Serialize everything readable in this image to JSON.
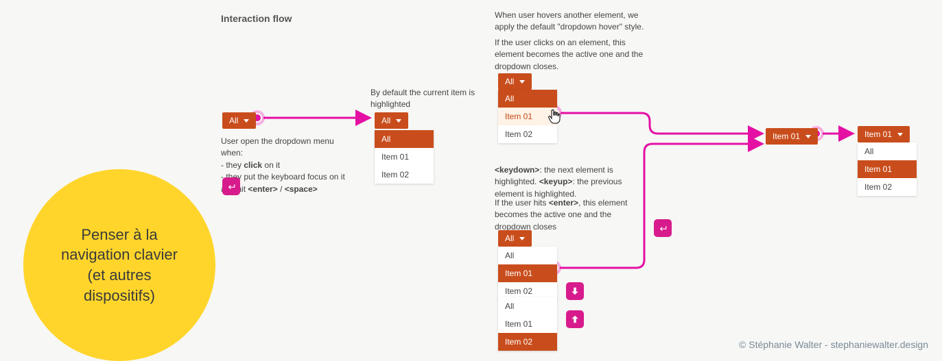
{
  "title": "Interaction flow",
  "circle_text": "Penser à la navigation clavier (et autres dispositifs)",
  "col1": {
    "btn": "All",
    "desc_line1": "User open the dropdown menu when:",
    "desc_line2_a": "- they ",
    "desc_line2_b": "click",
    "desc_line2_c": " on it",
    "desc_line3_a": "- they put the keyboard focus on it and hit ",
    "desc_line3_b": "<enter>",
    "desc_line3_c": " / ",
    "desc_line3_d": "<space>"
  },
  "col2": {
    "desc": "By default the current item is highlighted",
    "btn": "All",
    "items": [
      "All",
      "Item 01",
      "Item 02"
    ]
  },
  "col3_top": {
    "desc1": "When user hovers another element, we apply the default \"dropdown hover\" style.",
    "desc2": "If the user clicks on an element, this element becomes the active one and the dropdown closes.",
    "btn": "All",
    "items": [
      "All",
      "Item 01",
      "Item 02"
    ]
  },
  "col3_bot": {
    "desc1a": "<keydown>",
    "desc1b": ": the next element is highlighted. ",
    "desc1c": "<keyup>",
    "desc1d": ": the previous element is highlighted.",
    "desc2a": "If the user hits ",
    "desc2b": "<enter>",
    "desc2c": ", this element becomes the active one and the dropdown closes",
    "btn": "All",
    "listA": [
      "All",
      "Item 01",
      "Item 02"
    ],
    "listB": [
      "All",
      "Item 01",
      "Item 02"
    ]
  },
  "col4": {
    "btn": "Item 01"
  },
  "col5": {
    "btn": "Item 01",
    "items": [
      "All",
      "Item 01",
      "Item 02"
    ]
  },
  "credit": "© Stéphanie Walter - stephaniewalter.design"
}
